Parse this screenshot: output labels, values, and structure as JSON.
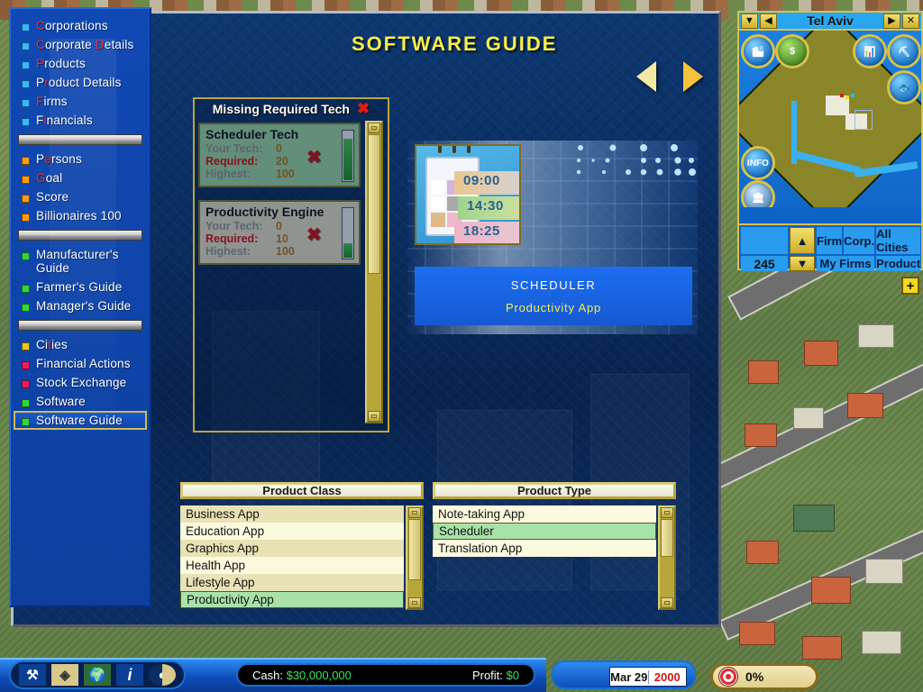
{
  "window": {
    "page_title": "SOFTWARE GUIDE"
  },
  "sidebar": {
    "groups": [
      {
        "color": "#35b8ff",
        "items": [
          {
            "label": "Corporations",
            "hotkey": "C",
            "selected": false
          },
          {
            "label": "Corporate Details",
            "hotkey": "D",
            "selected": false
          },
          {
            "label": "Products",
            "hotkey": "P",
            "selected": false
          },
          {
            "label": "Product Details",
            "hotkey": "r",
            "selected": false
          },
          {
            "label": "Firms",
            "hotkey": "F",
            "selected": false
          },
          {
            "label": "Financials",
            "hotkey": "i",
            "selected": false
          }
        ]
      },
      {
        "color": "#ff9c10",
        "items": [
          {
            "label": "Persons",
            "hotkey": "e",
            "selected": false
          },
          {
            "label": "Goal",
            "hotkey": "G",
            "selected": false
          },
          {
            "label": "Score",
            "hotkey": "",
            "selected": false
          },
          {
            "label": "Billionaires 100",
            "hotkey": "",
            "selected": false
          }
        ]
      },
      {
        "color": "#2fd83a",
        "items": [
          {
            "label": "Manufacturer's\nGuide",
            "hotkey": "",
            "selected": false
          },
          {
            "label": "Farmer's Guide",
            "hotkey": "",
            "selected": false
          },
          {
            "label": "Manager's Guide",
            "hotkey": "",
            "selected": false
          }
        ]
      },
      {
        "color": "#mixed",
        "items": [
          {
            "label": "Cities",
            "hotkey": "t",
            "selected": false,
            "bullet": "#f2c31a"
          },
          {
            "label": "Financial Actions",
            "hotkey": "",
            "selected": false,
            "bullet": "#ee1b5c"
          },
          {
            "label": "Stock Exchange",
            "hotkey": "",
            "selected": false,
            "bullet": "#ee1b5c"
          },
          {
            "label": "Software",
            "hotkey": "",
            "selected": false,
            "bullet": "#2fd83a"
          },
          {
            "label": "Software Guide",
            "hotkey": "",
            "selected": true,
            "bullet": "#2fd83a"
          }
        ]
      }
    ]
  },
  "tech_panel": {
    "header": "Missing Required Tech",
    "header_icon": "x-mark-icon",
    "labels": {
      "your_tech": "Your Tech:",
      "required": "Required:",
      "highest": "Highest:"
    },
    "cards": [
      {
        "name": "Scheduler Tech",
        "your_tech": "0",
        "required": "20",
        "highest": "100",
        "status_icon": "x-mark-icon",
        "gauge_pct": 82,
        "highlight": true
      },
      {
        "name": "Productivity Engine",
        "your_tech": "0",
        "required": "10",
        "highest": "100",
        "status_icon": "x-mark-icon",
        "gauge_pct": 28,
        "highlight": false
      }
    ]
  },
  "showcase": {
    "product_icon": "calendar-scheduler-icon",
    "icon_times": [
      "09:00",
      "14:30",
      "18:25"
    ],
    "product_name": "SCHEDULER",
    "product_class": "Productivity App"
  },
  "product_class_list": {
    "header": "Product Class",
    "items": [
      "Business App",
      "Education App",
      "Graphics App",
      "Health App",
      "Lifestyle App",
      "Productivity App"
    ],
    "selected": "Productivity App"
  },
  "product_type_list": {
    "header": "Product Type",
    "items": [
      "Note-taking App",
      "Scheduler",
      "Translation App"
    ],
    "selected": "Scheduler"
  },
  "minimap": {
    "title": "Tel Aviv",
    "title_buttons": [
      "▼",
      "◀",
      "▶",
      "✕"
    ],
    "round_buttons": [
      {
        "name": "city-view-icon",
        "glyph": "🏙"
      },
      {
        "name": "economy-dollar-icon",
        "glyph": "$"
      },
      {
        "name": "stock-chart-icon",
        "glyph": "📊"
      },
      {
        "name": "mining-pickaxe-icon",
        "glyph": "⛏"
      },
      {
        "name": "fishing-icon",
        "glyph": "🐟"
      },
      {
        "name": "info-icon",
        "glyph": "INFO"
      },
      {
        "name": "building-icon",
        "glyph": "🏛"
      }
    ],
    "counter": "245",
    "buttons": [
      "Firm",
      "Corp.",
      "All Cities",
      "My Firms",
      "Product"
    ],
    "add_button": "+"
  },
  "statusbar": {
    "tools": [
      {
        "name": "build-tools-icon",
        "glyph": "⚒"
      },
      {
        "name": "map-grid-icon",
        "glyph": "◈"
      },
      {
        "name": "world-map-icon",
        "glyph": "🌍"
      },
      {
        "name": "info-icon",
        "glyph": "i"
      },
      {
        "name": "speed-dial-icon",
        "glyph": "◐"
      }
    ],
    "cash_label": "Cash:",
    "cash_value": "$30,000,000",
    "profit_label": "Profit:",
    "profit_value": "$0",
    "date": "Mar 29",
    "year": "2000",
    "progress": "0%",
    "progress_icon": "target-icon"
  },
  "colors": {
    "accent_gold": "#d6c24b",
    "panel_blue": "#0b2f63",
    "sidebar_blue": "#1149b4",
    "selected_green": "#a8e2a8",
    "title_yellow": "#f7f04a",
    "cash_green": "#3ce05a"
  }
}
